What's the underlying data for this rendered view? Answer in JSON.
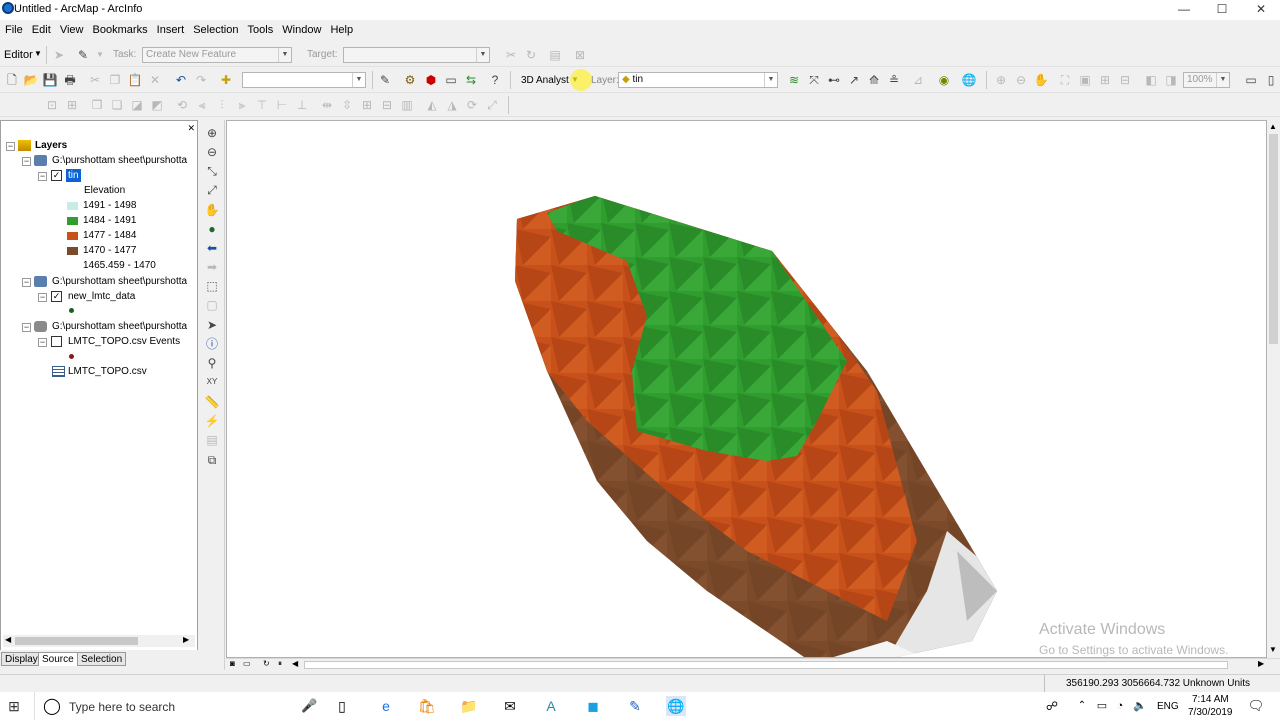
{
  "window": {
    "title": "Untitled - ArcMap - ArcInfo",
    "minimize": "—",
    "maximize": "☐",
    "close": "✕"
  },
  "menu": {
    "file": "File",
    "edit": "Edit",
    "view": "View",
    "bookmarks": "Bookmarks",
    "insert": "Insert",
    "selection": "Selection",
    "tools": "Tools",
    "window": "Window",
    "help": "Help"
  },
  "editor_toolbar": {
    "editor_label": "Editor",
    "task_label": "Task:",
    "task_value": "Create New Feature",
    "target_label": "Target:",
    "target_value": ""
  },
  "standard_toolbar": {
    "scale_value": "",
    "analyst_label": "3D Analyst",
    "layer_label": "Layer:",
    "layer_value": "tin",
    "zoom_value": "100%"
  },
  "toc": {
    "root": "Layers",
    "group1": {
      "path": "G:\\purshottam sheet\\purshotta",
      "layer": "tin",
      "field": "Elevation",
      "classes": [
        {
          "label": "1491 - 1498",
          "color": "#c6ece6"
        },
        {
          "label": "1484 - 1491",
          "color": "#2f9e2f"
        },
        {
          "label": "1477 - 1484",
          "color": "#c8501a"
        },
        {
          "label": "1470 - 1477",
          "color": "#7a4a2a"
        },
        {
          "label": "1465.459 - 1470",
          "color": "#ffffff"
        }
      ]
    },
    "group2": {
      "path": "G:\\purshottam sheet\\purshotta",
      "layer": "new_lmtc_data"
    },
    "group3": {
      "path": "G:\\purshottam sheet\\purshotta",
      "layer": "LMTC_TOPO.csv Events",
      "table": "LMTC_TOPO.csv"
    },
    "tabs": {
      "display": "Display",
      "source": "Source",
      "selection": "Selection"
    }
  },
  "watermark": {
    "title": "Activate Windows",
    "subtitle": "Go to Settings to activate Windows."
  },
  "status": {
    "coords": "356190.293  3056664.732 Unknown Units"
  },
  "taskbar": {
    "search_placeholder": "Type here to search",
    "lang": "ENG",
    "time": "7:14 AM",
    "date": "7/30/2019"
  },
  "colors": {
    "tin_green": "#2f9e2f",
    "tin_orange": "#c8501a",
    "tin_brown": "#7a4a2a",
    "tin_white": "#e6e6e6",
    "selected_layer": "#0a64d8"
  }
}
